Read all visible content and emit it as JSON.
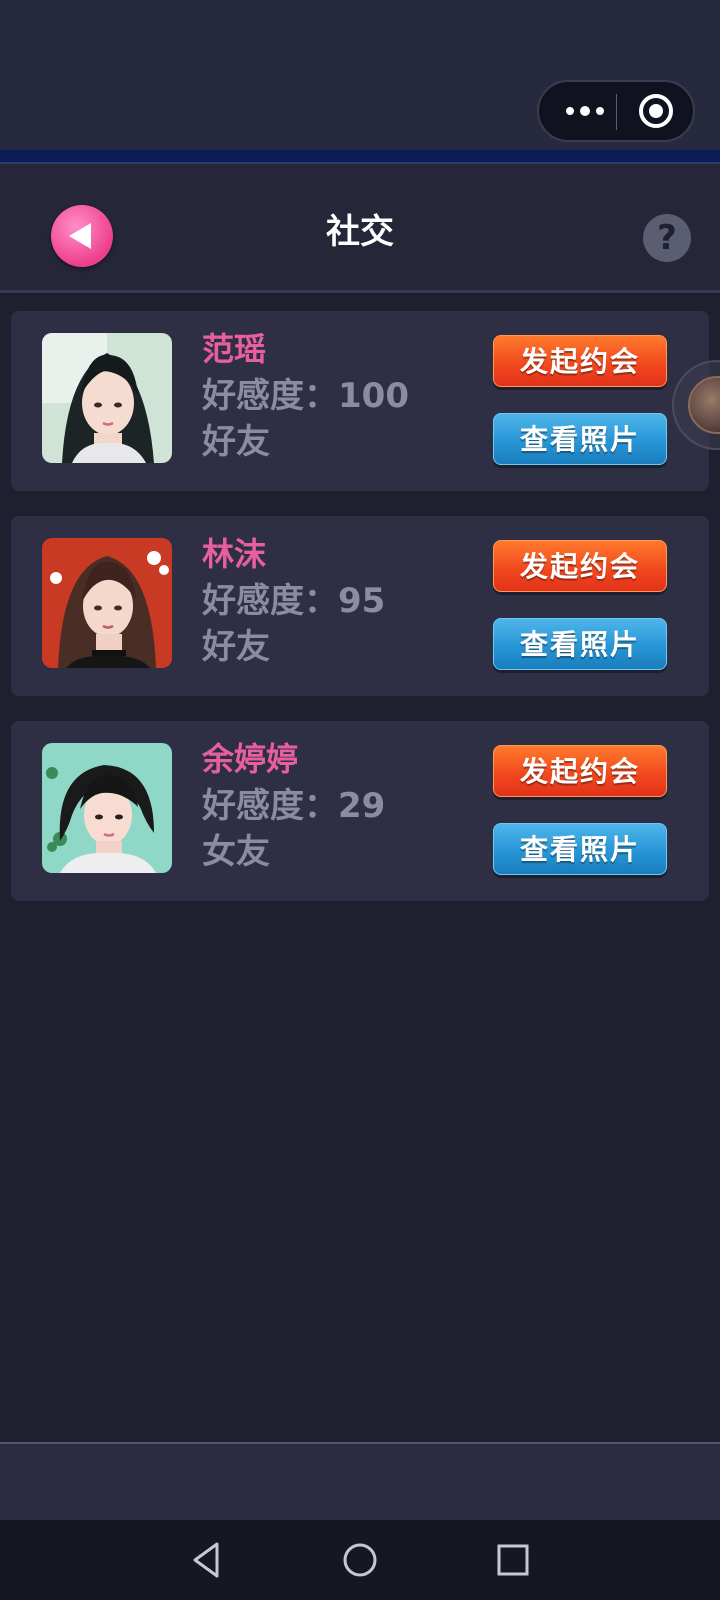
{
  "header": {
    "title": "社交"
  },
  "contacts": [
    {
      "name": "范瑶",
      "favor_label": "好感度：100",
      "relation": "好友",
      "date_label": "发起约会",
      "photo_label": "查看照片"
    },
    {
      "name": "林沫",
      "favor_label": "好感度：95",
      "relation": "好友",
      "date_label": "发起约会",
      "photo_label": "查看照片"
    },
    {
      "name": "余婷婷",
      "favor_label": "好感度：29",
      "relation": "女友",
      "date_label": "发起约会",
      "photo_label": "查看照片"
    }
  ],
  "colors": {
    "background": "#1f1f30",
    "card": "#2e2f45",
    "name": "#e85fa0",
    "muted_text": "#8a8ca4",
    "date_button": "#f24a1e",
    "photo_button": "#2796d6",
    "back_button": "#ee3f8f"
  },
  "icons": {
    "back": "back-arrow-icon",
    "help": "question-icon",
    "more": "more-dots-icon",
    "close_miniprogram": "target-circle-icon",
    "nav_back": "triangle-back-icon",
    "nav_home": "circle-home-icon",
    "nav_recent": "square-recent-icon"
  }
}
